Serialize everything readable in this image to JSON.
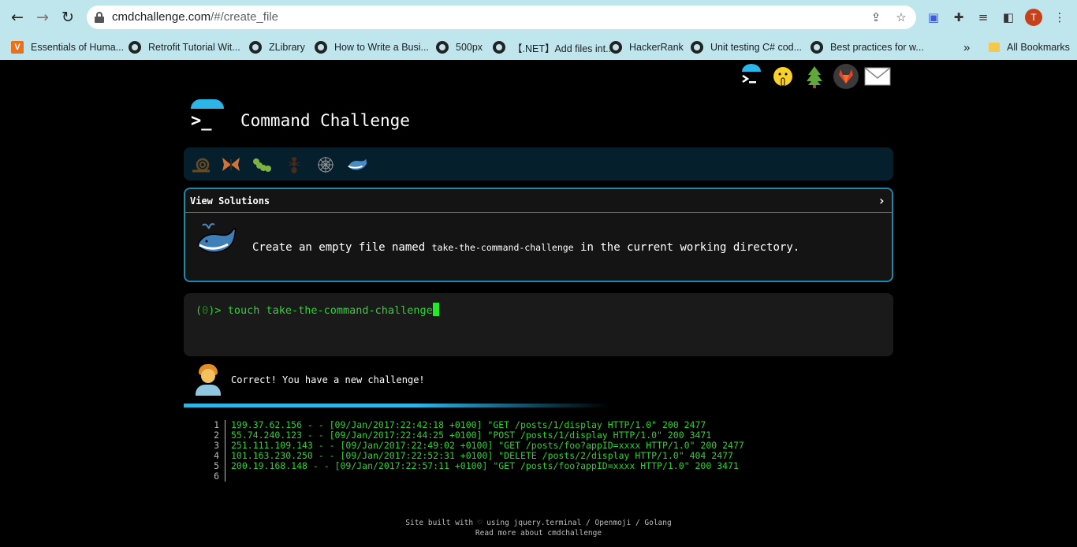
{
  "browser": {
    "url_host": "cmdchallenge.com",
    "url_path": "/#/create_file",
    "avatar_letter": "T",
    "bookmarks": [
      {
        "label": "Essentials of Huma...",
        "icon": "v-logo-icon"
      },
      {
        "label": "Retrofit Tutorial Wit...",
        "icon": "globe-icon"
      },
      {
        "label": "ZLibrary",
        "icon": "globe-icon"
      },
      {
        "label": "How to Write a Busi...",
        "icon": "globe-icon"
      },
      {
        "label": "500px",
        "icon": "globe-icon"
      },
      {
        "label": "【.NET】Add files int...",
        "icon": "globe-icon"
      },
      {
        "label": "HackerRank",
        "icon": "globe-icon"
      },
      {
        "label": "Unit testing C# cod...",
        "icon": "globe-icon"
      },
      {
        "label": "Best practices for w...",
        "icon": "globe-icon"
      }
    ],
    "overflow": "»",
    "all_bookmarks": "All Bookmarks"
  },
  "header": {
    "title": "Command Challenge",
    "logo_glyph": ">_",
    "top_icons": [
      "cmdchallenge-icon",
      "shushing-face-icon",
      "tree-icon",
      "gitlab-icon",
      "envelope-icon"
    ]
  },
  "levels": [
    "snail-icon",
    "butterfly-icon",
    "caterpillar-icon",
    "ant-icon",
    "spider-web-icon",
    "whale-icon"
  ],
  "challenge": {
    "view_solutions": "View Solutions",
    "arrow": "›",
    "text_before": "Create an empty file named",
    "filename": "take-the-command-challenge",
    "text_after": "in the current working directory."
  },
  "terminal": {
    "prompt_open": "(",
    "prompt_code": "0",
    "prompt_close": ")>",
    "command": "touch take-the-command-challenge"
  },
  "result": {
    "message": "Correct! You have a new challenge!"
  },
  "log_lines": [
    {
      "num": "1",
      "text": "199.37.62.156 - - [09/Jan/2017:22:42:18 +0100] \"GET /posts/1/display HTTP/1.0\" 200 2477"
    },
    {
      "num": "2",
      "text": "55.74.240.123 - - [09/Jan/2017:22:44:25 +0100] \"POST /posts/1/display HTTP/1.0\" 200 3471"
    },
    {
      "num": "3",
      "text": "251.111.109.143 - - [09/Jan/2017:22:49:02 +0100] \"GET /posts/foo?appID=xxxx HTTP/1.0\" 200 2477"
    },
    {
      "num": "4",
      "text": "101.163.230.250 - - [09/Jan/2017:22:52:31 +0100] \"DELETE /posts/2/display HTTP/1.0\" 404 2477"
    },
    {
      "num": "5",
      "text": "200.19.168.148 - - [09/Jan/2017:22:57:11 +0100] \"GET /posts/foo?appID=xxxx HTTP/1.0\" 200 3471"
    },
    {
      "num": "6",
      "text": ""
    }
  ],
  "footer": {
    "line1": "Site built with ♡ using jquery.terminal / Openmoji / Golang",
    "line2": "Read more about cmdchallenge"
  },
  "colors": {
    "accent": "#2db5e8",
    "terminal_green": "#28d52e",
    "border_blue": "#1b89ad"
  }
}
